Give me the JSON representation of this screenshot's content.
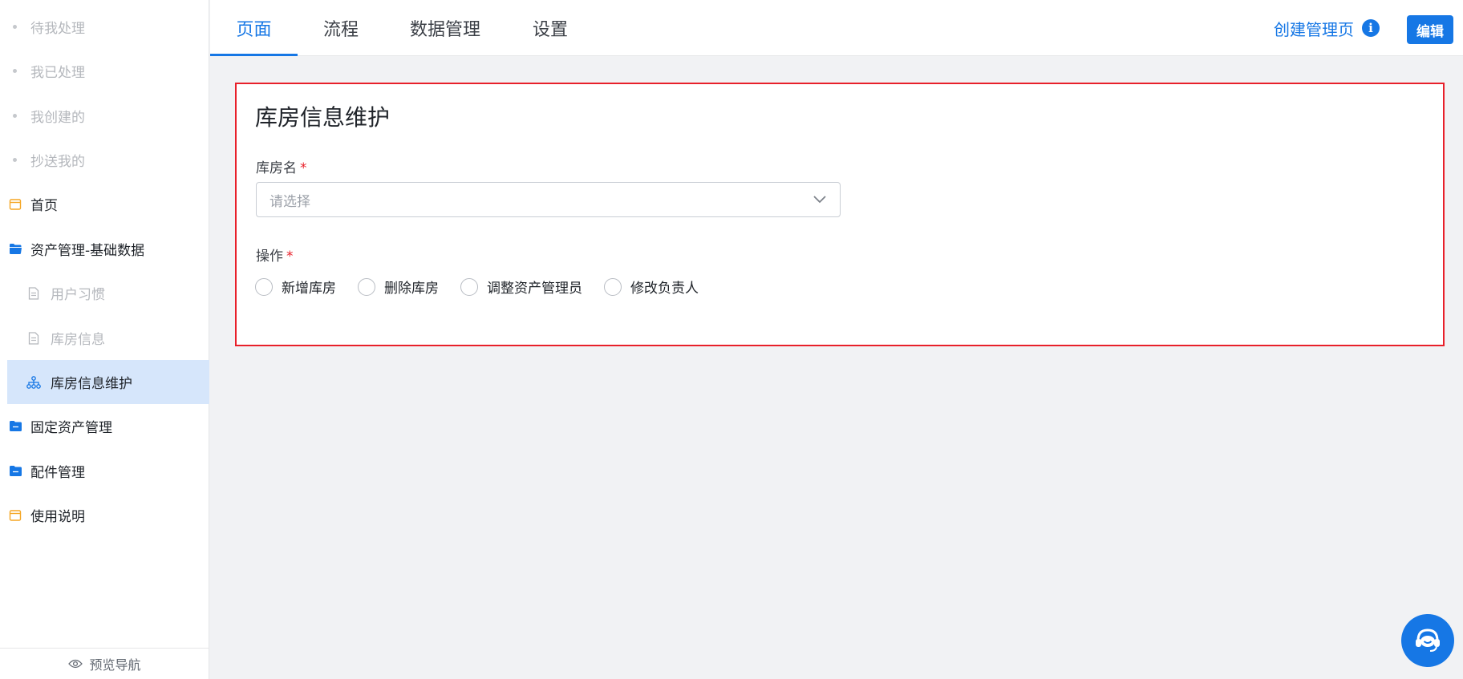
{
  "sidebar": {
    "items": [
      {
        "label": "待我处理"
      },
      {
        "label": "我已处理"
      },
      {
        "label": "我创建的"
      },
      {
        "label": "抄送我的"
      },
      {
        "label": "首页"
      },
      {
        "label": "资产管理-基础数据"
      },
      {
        "label": "用户习惯"
      },
      {
        "label": "库房信息"
      },
      {
        "label": "库房信息维护"
      },
      {
        "label": "固定资产管理"
      },
      {
        "label": "配件管理"
      },
      {
        "label": "使用说明"
      }
    ],
    "footer": "预览导航"
  },
  "header": {
    "tabs": [
      {
        "label": "页面"
      },
      {
        "label": "流程"
      },
      {
        "label": "数据管理"
      },
      {
        "label": "设置"
      }
    ],
    "create_link": "创建管理页",
    "info_icon": "i",
    "edit_label": "编辑"
  },
  "form": {
    "title": "库房信息维护",
    "warehouse_label": "库房名",
    "required_mark": "*",
    "warehouse_placeholder": "请选择",
    "operation_label": "操作",
    "options": [
      {
        "label": "新增库房"
      },
      {
        "label": "删除库房"
      },
      {
        "label": "调整资产管理员"
      },
      {
        "label": "修改负责人"
      }
    ]
  },
  "colors": {
    "accent": "#1677e5",
    "required": "#e8202a",
    "highlight_border": "#e8202a",
    "active_nav_bg": "#d6e6fb"
  }
}
